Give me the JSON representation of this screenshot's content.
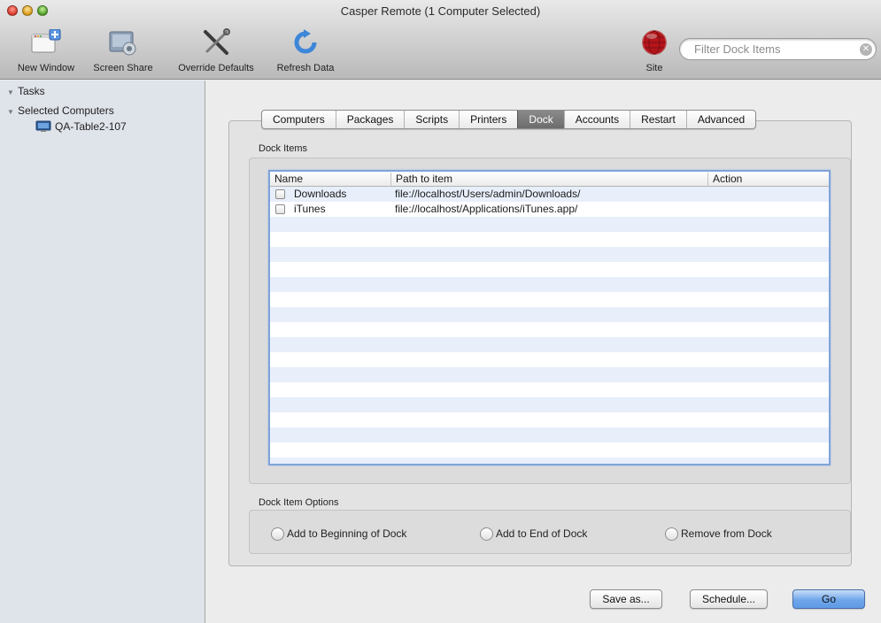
{
  "window": {
    "title": "Casper Remote (1 Computer Selected)"
  },
  "toolbar": {
    "new_window": "New Window",
    "screen_share": "Screen Share",
    "override_defaults": "Override Defaults",
    "refresh_data": "Refresh Data",
    "site": "Site"
  },
  "filter": {
    "placeholder": "Filter Dock Items"
  },
  "sidebar": {
    "tasks": "Tasks",
    "selected_computers": "Selected Computers",
    "computer": "QA-Table2-107"
  },
  "tabs": [
    "Computers",
    "Packages",
    "Scripts",
    "Printers",
    "Dock",
    "Accounts",
    "Restart",
    "Advanced"
  ],
  "active_tab": "Dock",
  "dock_items": {
    "group_label": "Dock Items",
    "columns": {
      "name": "Name",
      "path": "Path to item",
      "action": "Action"
    },
    "rows": [
      {
        "name": "Downloads",
        "path": "file://localhost/Users/admin/Downloads/",
        "action": ""
      },
      {
        "name": "iTunes",
        "path": "file://localhost/Applications/iTunes.app/",
        "action": ""
      }
    ]
  },
  "dock_options": {
    "group_label": "Dock Item Options",
    "add_beginning": "Add to Beginning of Dock",
    "add_end": "Add to End of Dock",
    "remove": "Remove from Dock"
  },
  "buttons": {
    "save_as": "Save as...",
    "schedule": "Schedule...",
    "go": "Go"
  },
  "colors": {
    "active_tab": "#757575",
    "selection_blue": "#7fa3d8",
    "row_stripe": "#e8effb",
    "go_button": "#6fa6ea"
  }
}
